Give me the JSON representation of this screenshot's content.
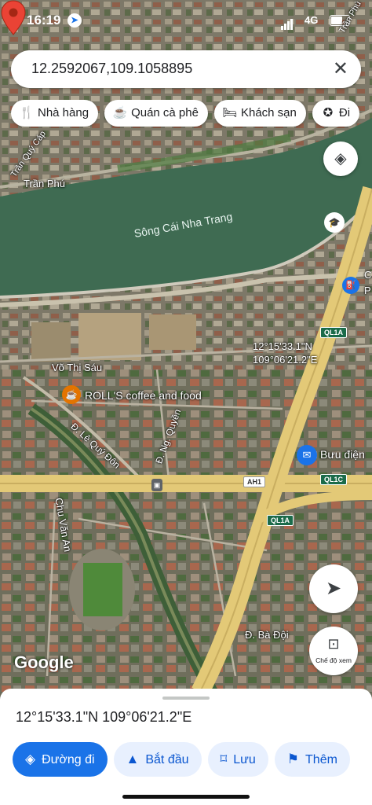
{
  "status_bar": {
    "time": "16:19",
    "network": "4G"
  },
  "search": {
    "query": "12.2592067,109.1058895",
    "clear_icon": "close-icon"
  },
  "chips": [
    {
      "icon": "restaurant-icon",
      "glyph": "🍴",
      "label": "Nhà hàng"
    },
    {
      "icon": "coffee-icon",
      "glyph": "☕",
      "label": "Quán cà phê"
    },
    {
      "icon": "hotel-icon",
      "glyph": "🛏",
      "label": "Khách sạn"
    },
    {
      "icon": "attraction-icon",
      "glyph": "✪",
      "label": "Đi"
    }
  ],
  "map_labels": {
    "river": "Sông Cái Nha Trang",
    "tran_phu": "Trần Phú",
    "tran_quy_cap": "Trần Quý Cáp",
    "tran_phu_right": "Trần Phú",
    "vo_thi_sau": "Võ Thị Sáu",
    "poi_coffee": "ROLL'S coffee and food",
    "le_quy_don": "Đ. Lê Quý Đôn",
    "ng_quyen": "Đ. Ng. Quyền",
    "chu_van_an": "Chu Văn An",
    "ba_doi": "Đ. Bà Đội",
    "post_office": "Bưu điện",
    "edge_c": "C",
    "edge_p": "P",
    "shield_ql1a_top": "QL1A",
    "shield_ah1": "AH1",
    "shield_ql1c": "QL1C",
    "shield_ql1a_bottom": "QL1A",
    "google_logo": "Google"
  },
  "pin": {
    "lat_dms": "12°15'33.1\"N",
    "lng_dms": "109°06'21.2\"E"
  },
  "controls": {
    "view_mode_label": "Chế độ xem"
  },
  "sheet": {
    "coordinates": "12°15'33.1\"N 109°06'21.2\"E",
    "actions": [
      {
        "icon": "directions-icon",
        "glyph": "◈",
        "label": "Đường đi",
        "primary": true
      },
      {
        "icon": "navigate-icon",
        "glyph": "▲",
        "label": "Bắt đầu",
        "primary": false
      },
      {
        "icon": "bookmark-icon",
        "glyph": "⌑",
        "label": "Lưu",
        "primary": false
      },
      {
        "icon": "flag-icon",
        "glyph": "⚑",
        "label": "Thêm",
        "primary": false
      }
    ]
  },
  "colors": {
    "accent": "#1a73e8",
    "river": "#3f6b52",
    "highway": "#e3c977",
    "pin": "#ea4335"
  }
}
